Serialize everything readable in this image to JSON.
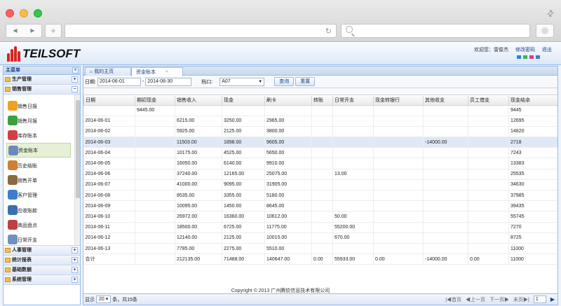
{
  "header": {
    "logo_text": "TEILSOFT",
    "welcome": "欢迎您：雷俊杰",
    "change_password": "修改密码",
    "logout": "退出",
    "swatches": [
      "#1a8ad6",
      "#3cb44b",
      "#d83c8c",
      "#3a7bd5"
    ]
  },
  "sidebar": {
    "title": "主菜单",
    "collapse_glyph": "«",
    "groups_top": [
      {
        "label": "生产管理",
        "toggle": "+"
      },
      {
        "label": "销售管理",
        "toggle": "−"
      }
    ],
    "items": [
      {
        "label": "销售日报",
        "icon": "pie-chart-icon",
        "color": "#f0a020"
      },
      {
        "label": "销售月报",
        "icon": "puzzle-icon",
        "color": "#3aa040"
      },
      {
        "label": "库存账本",
        "icon": "calendar-icon",
        "color": "#d04040"
      },
      {
        "label": "资金账本",
        "icon": "ledger-icon",
        "color": "#6a8bc0"
      },
      {
        "label": "历史结账",
        "icon": "lock-icon",
        "color": "#d08030"
      },
      {
        "label": "销售开单",
        "icon": "hand-icon",
        "color": "#8a6a40"
      },
      {
        "label": "客户管理",
        "icon": "user-icon",
        "color": "#3a80d0"
      },
      {
        "label": "应收账款",
        "icon": "card-icon",
        "color": "#3a70b0"
      },
      {
        "label": "商品盘点",
        "icon": "grid-icon",
        "color": "#c04040"
      },
      {
        "label": "日常开支",
        "icon": "document-icon",
        "color": "#7090c0"
      }
    ],
    "groups_bottom": [
      {
        "label": "人事管理",
        "toggle": "+"
      },
      {
        "label": "统计报表",
        "toggle": "+"
      },
      {
        "label": "基础数据",
        "toggle": "+"
      },
      {
        "label": "系统管理",
        "toggle": "+"
      }
    ]
  },
  "tabs": [
    {
      "label": "我的主页",
      "icon": "⌂"
    },
    {
      "label": "资金账本",
      "close": "×"
    }
  ],
  "filter": {
    "date_label": "日期:",
    "date_from": "2014-06-01",
    "dash": "-",
    "date_to": "2014-06-30",
    "stall_label": "档口:",
    "stall_value": "A07",
    "query": "查询",
    "reset": "重置"
  },
  "table": {
    "columns": [
      "日期",
      "期初现金",
      "销售收入",
      "现金",
      "刷卡",
      "转账",
      "日常开支",
      "现金转银行",
      "其他收支",
      "员工借支",
      "现金结余"
    ],
    "rows": [
      [
        "",
        "9445.00",
        "",
        "",
        "",
        "",
        "",
        "",
        "",
        "",
        "9445"
      ],
      [
        "2014-06-01",
        "",
        "6215.00",
        "3250.00",
        "2965.00",
        "",
        "",
        "",
        "",
        "",
        "12695"
      ],
      [
        "2014-06-02",
        "",
        "5925.00",
        "2125.00",
        "3800.00",
        "",
        "",
        "",
        "",
        "",
        "14820"
      ],
      [
        "2014-06-03",
        "",
        "11503.00",
        "1898.00",
        "9605.00",
        "",
        "",
        "",
        "-14000.00",
        "",
        "2718"
      ],
      [
        "2014-06-04",
        "",
        "10175.00",
        "4525.00",
        "5650.00",
        "",
        "",
        "",
        "",
        "",
        "7243"
      ],
      [
        "2014-06-05",
        "",
        "16050.00",
        "6140.00",
        "9910.00",
        "",
        "",
        "",
        "",
        "",
        "13383"
      ],
      [
        "2014-06-06",
        "",
        "37240.00",
        "12165.00",
        "25075.00",
        "",
        "13.00",
        "",
        "",
        "",
        "25535"
      ],
      [
        "2014-06-07",
        "",
        "41000.00",
        "9095.00",
        "31905.00",
        "",
        "",
        "",
        "",
        "",
        "34630"
      ],
      [
        "2014-06-08",
        "",
        "8535.00",
        "3355.00",
        "5180.00",
        "",
        "",
        "",
        "",
        "",
        "37985"
      ],
      [
        "2014-06-09",
        "",
        "10095.00",
        "1450.00",
        "8645.00",
        "",
        "",
        "",
        "",
        "",
        "39435"
      ],
      [
        "2014-06-10",
        "",
        "26972.00",
        "16360.00",
        "10612.00",
        "",
        "50.00",
        "",
        "",
        "",
        "55745"
      ],
      [
        "2014-06-11",
        "",
        "18500.00",
        "6725.00",
        "11775.00",
        "",
        "55200.00",
        "",
        "",
        "",
        "7270"
      ],
      [
        "2014-06-12",
        "",
        "12140.00",
        "2125.00",
        "10015.00",
        "",
        "670.00",
        "",
        "",
        "",
        "8725"
      ],
      [
        "2014-06-13",
        "",
        "7785.00",
        "2275.00",
        "5510.00",
        "",
        "",
        "",
        "",
        "",
        "11000"
      ],
      [
        "合计",
        "",
        "212135.00",
        "71488.00",
        "140647.00",
        "0.00",
        "55933.00",
        "0.00",
        "-14000.00",
        "0.00",
        "11000"
      ]
    ],
    "highlight_row": 3
  },
  "pager": {
    "show": "显示",
    "page_size": "20",
    "suffix": "条，共15条",
    "first": "|◀首页",
    "prev": "◀上一页",
    "next": "下一页▶",
    "last": "末页▶|",
    "page": "1",
    "go": "▶"
  },
  "footer": {
    "copyright": "Copyright © 2013 广州腾钦信息技术有限公司"
  }
}
